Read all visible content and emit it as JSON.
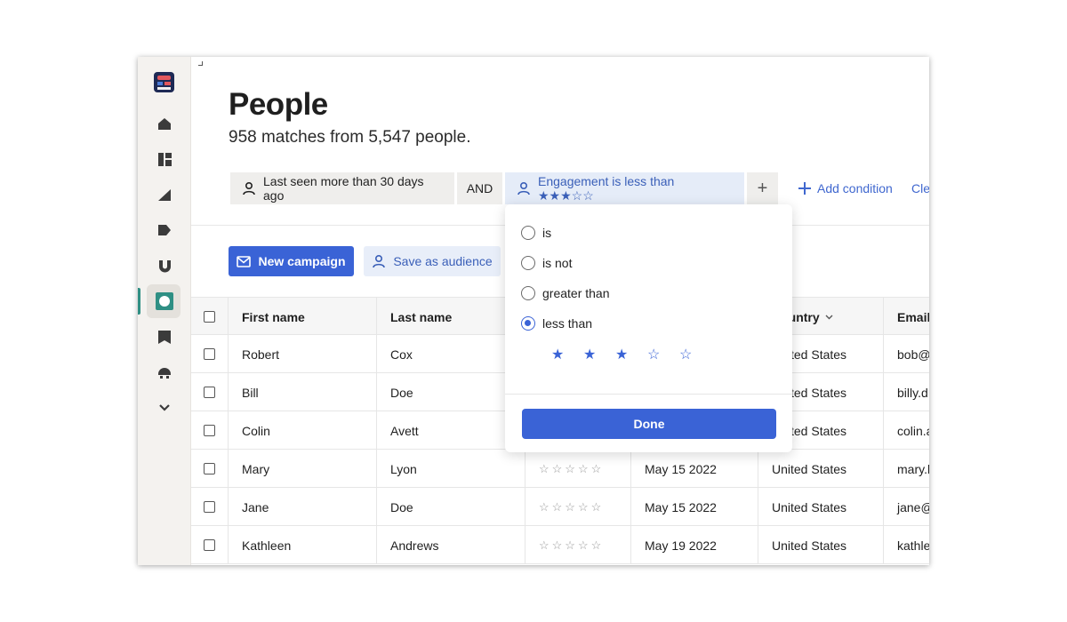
{
  "header": {
    "title": "People",
    "subtitle": "958 matches from 5,547 people."
  },
  "filters": {
    "last_seen": "Last seen more than 30 days ago",
    "joiner": "AND",
    "engagement": "Engagement is less than ★★★☆☆",
    "add_condition": "Add condition",
    "clear": "Clear"
  },
  "actions": {
    "new_campaign": "New campaign",
    "save_audience": "Save as audience"
  },
  "table": {
    "columns": [
      "First name",
      "Last name",
      "",
      "",
      "Country",
      "Email"
    ],
    "rows": [
      {
        "first": "Robert",
        "last": "Cox",
        "engagement": "",
        "date": "",
        "country": "United States",
        "email": "bob@"
      },
      {
        "first": "Bill",
        "last": "Doe",
        "engagement": "",
        "date": "",
        "country": "United States",
        "email": "billy.d"
      },
      {
        "first": "Colin",
        "last": "Avett",
        "engagement": "",
        "date": "",
        "country": "United States",
        "email": "colin.a"
      },
      {
        "first": "Mary",
        "last": "Lyon",
        "engagement": "☆☆☆☆☆",
        "date": "May 15 2022",
        "country": "United States",
        "email": "mary.l"
      },
      {
        "first": "Jane",
        "last": "Doe",
        "engagement": "☆☆☆☆☆",
        "date": "May 15 2022",
        "country": "United States",
        "email": "jane@"
      },
      {
        "first": "Kathleen",
        "last": "Andrews",
        "engagement": "☆☆☆☆☆",
        "date": "May 19 2022",
        "country": "United States",
        "email": "kathle"
      }
    ]
  },
  "popover": {
    "options": [
      "is",
      "is not",
      "greater than",
      "less than"
    ],
    "selected": "less than",
    "rating": 3,
    "rating_max": 5,
    "done": "Done"
  },
  "colors": {
    "accent": "#3a63d6",
    "chip_bg": "#efeeec",
    "nav_active": "#2f8f84"
  }
}
